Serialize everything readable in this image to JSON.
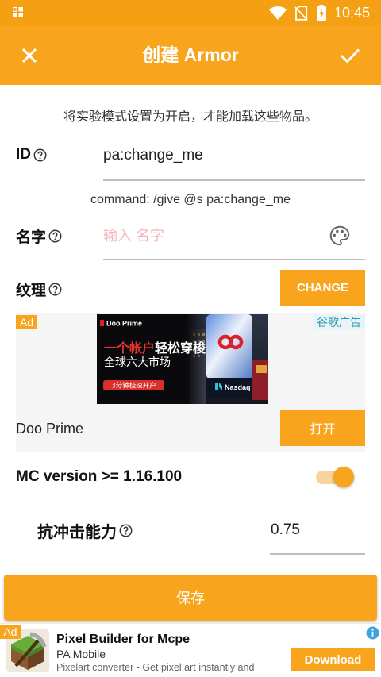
{
  "status_bar": {
    "time": "10:45",
    "icons": {
      "apps": "grid-icon",
      "wifi": "wifi-icon",
      "sim": "no-sim-icon",
      "battery": "battery-charging-icon"
    }
  },
  "app_bar": {
    "title": "创建 Armor",
    "close_icon": "close-icon",
    "confirm_icon": "check-icon"
  },
  "notice": "将实验模式设置为开启，才能加载这些物品。",
  "fields": {
    "id": {
      "label": "ID",
      "value": "pa:change_me",
      "help_icon": "help-icon"
    },
    "command": "command: /give @s pa:change_me",
    "name": {
      "label": "名字",
      "placeholder": "输入 名字",
      "help_icon": "help-icon",
      "action_icon": "palette-icon"
    },
    "texture": {
      "label": "纹理",
      "help_icon": "help-icon",
      "button_label": "CHANGE"
    },
    "mc_version": {
      "label": "MC version >= 1.16.100",
      "enabled": true
    },
    "knockback_resistance": {
      "label": "抗冲击能力",
      "value": "0.75",
      "help_icon": "help-icon"
    }
  },
  "native_ad": {
    "badge": "Ad",
    "network": "谷歌广告",
    "creative": {
      "brand": "Doo Prime",
      "headline_highlight": "一个帐户",
      "headline_rest": "轻松穿梭",
      "subheadline": "全球六大市场",
      "cta": "3分钟极速开户",
      "billboard_text": "Nasdaq"
    },
    "advertiser": "Doo Prime",
    "cta_label": "打开"
  },
  "save_button": "保存",
  "banner_ad": {
    "badge": "Ad",
    "app_icon": "pixel-builder-app-icon",
    "title": "Pixel Builder for Mcpe",
    "publisher": "PA Mobile",
    "description": "Pixelart converter - Get pixel art instantly and",
    "info_icon": "info-icon",
    "cta_label": "Download"
  },
  "colors": {
    "status": "#F4A012",
    "primary": "#F8A51D",
    "track": "#FAD29B",
    "ph": "#F4B6BE",
    "net-text": "#2F96B4",
    "net-bg": "#E6F4F7",
    "red": "#E3342F",
    "info": "#3FA3DE"
  }
}
